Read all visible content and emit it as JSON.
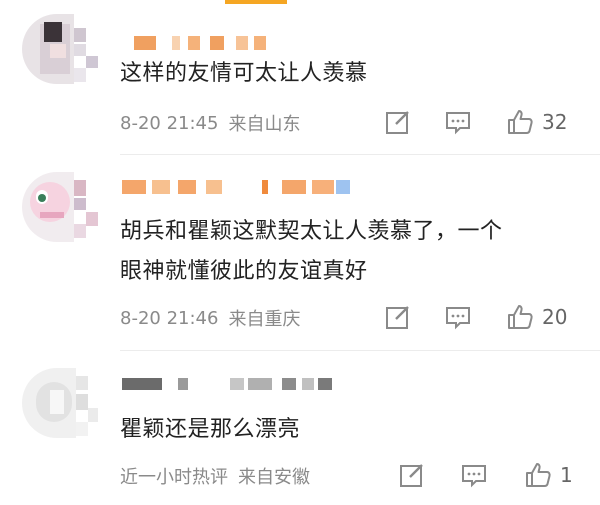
{
  "comments": [
    {
      "text": "这样的友情可太让人羡慕",
      "time": "8-20 21:45",
      "location": "来自山东",
      "likes": "32"
    },
    {
      "text_line1": "胡兵和瞿颖这默契太让人羡慕了，一个",
      "text_line2": "眼神就懂彼此的友谊真好",
      "time": "8-20 21:46",
      "location": "来自重庆",
      "likes": "20"
    },
    {
      "text": "瞿颖还是那么漂亮",
      "time": "近一小时热评",
      "location": "来自安徽",
      "likes": "1"
    }
  ],
  "colors": {
    "username_orange": "#f5a05a",
    "username_gray": "#555555",
    "meta_gray": "#8a8a8a",
    "text": "#222222"
  },
  "icons": [
    "edit-icon",
    "comment-icon",
    "like-icon"
  ]
}
